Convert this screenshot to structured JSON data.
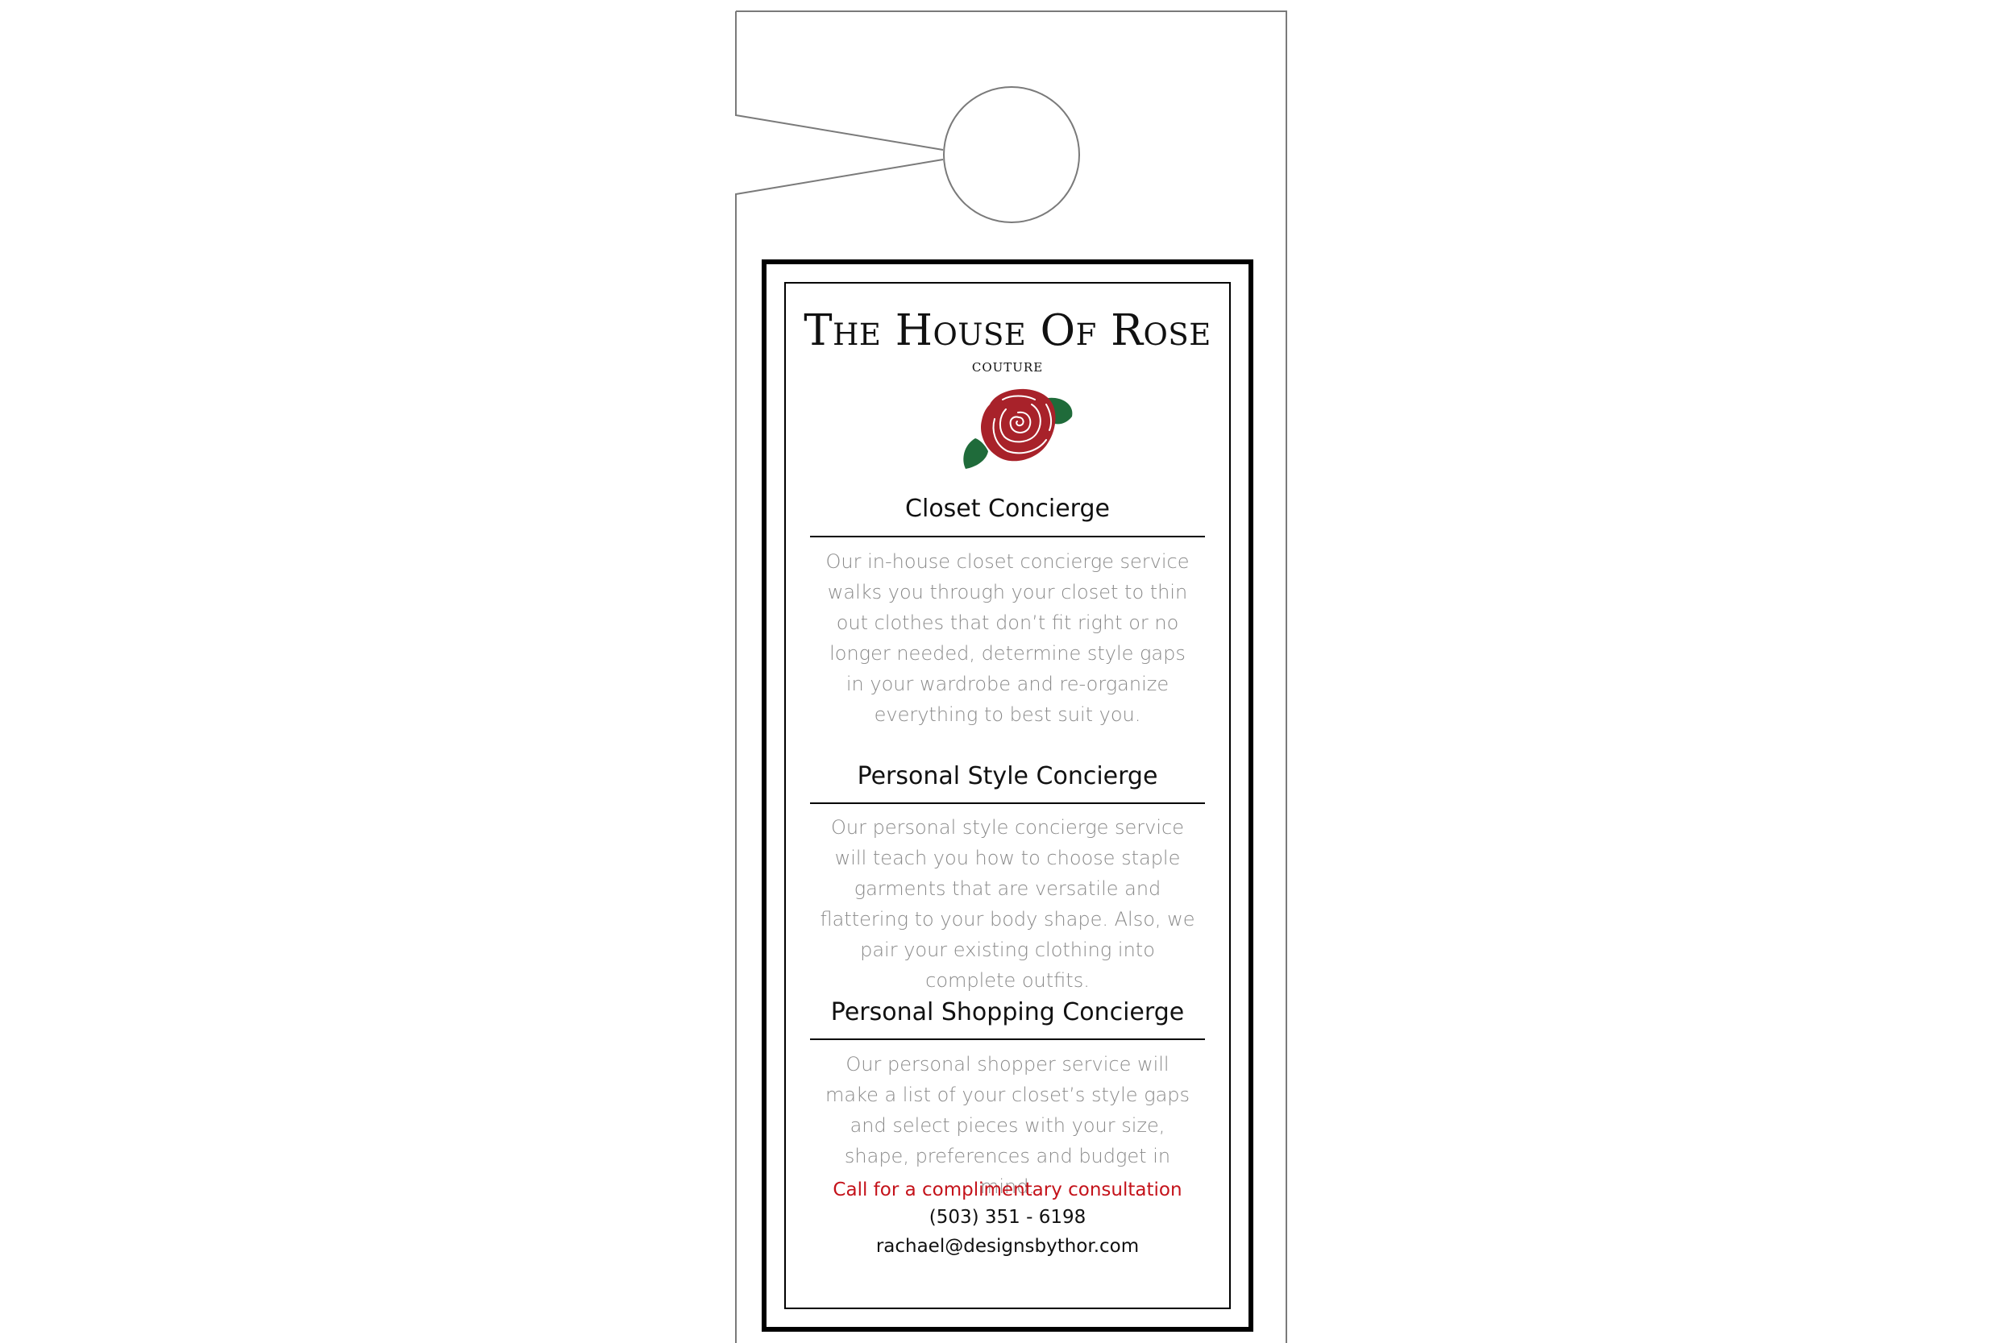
{
  "brand": {
    "name": "The House Of Rose",
    "tagline": "COUTURE",
    "logo_icon": "rose-icon",
    "rose_color": "#a8222a",
    "leaf_color": "#1f6b3a"
  },
  "sections": [
    {
      "title": "Closet Concierge",
      "body": "Our in-house closet concierge service walks you through your closet to thin out clothes that don’t fit right or no longer needed, determine style gaps in your wardrobe and re-organize everything to best suit you."
    },
    {
      "title": "Personal Style Concierge",
      "body": "Our personal style concierge service will teach you how to choose staple garments that are versatile and flattering to your body shape. Also, we pair your existing clothing into complete outfits."
    },
    {
      "title": "Personal Shopping Concierge",
      "body": "Our personal shopper service will make a list of your closet’s style gaps and select pieces with your size, shape, preferences and budget in mind."
    }
  ],
  "contact": {
    "cta": "Call for a complimentary consultation",
    "phone": "(503) 351 - 6198",
    "email": "rachael@designsbythor.com"
  },
  "colors": {
    "cta": "#c4121a",
    "body_text": "#8a8a8a",
    "border": "#000000"
  }
}
